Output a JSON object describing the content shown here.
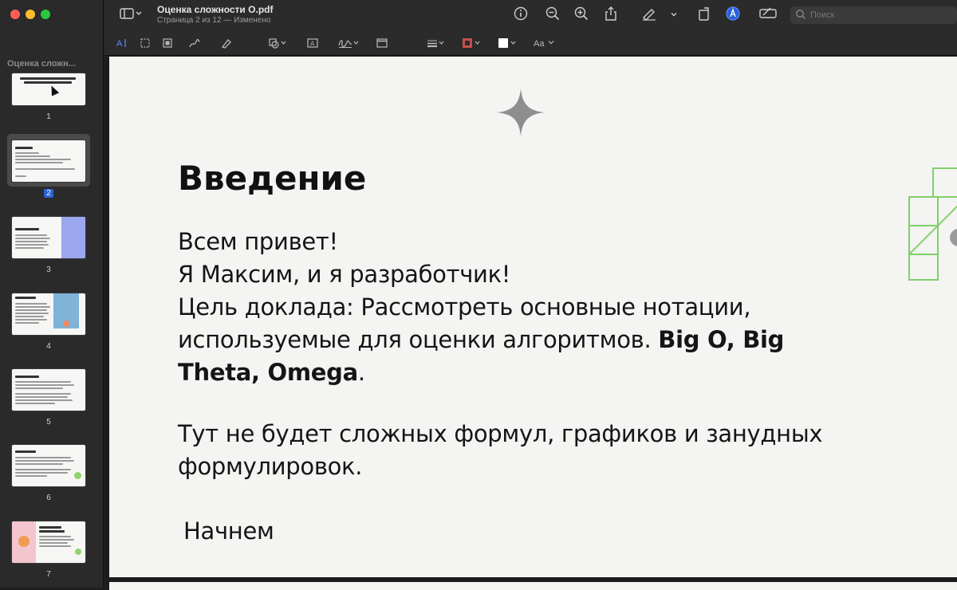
{
  "window": {
    "title": "Оценка сложности O.pdf",
    "subtitle": "Страница 2 из 12 — Изменено"
  },
  "sidebar": {
    "header": "Оценка сложн...",
    "pages": [
      {
        "num": "1",
        "thumb_title": "Оценка сложности алгоритмов и нотации Big O, Big Theta, Omega"
      },
      {
        "num": "2",
        "thumb_title": "Введение",
        "selected": true
      },
      {
        "num": "3",
        "thumb_title": "Оценка сложности"
      },
      {
        "num": "4",
        "thumb_title": "Нотация Big O"
      },
      {
        "num": "5",
        "thumb_title": "Нотация Big Theta"
      },
      {
        "num": "6",
        "thumb_title": "Нотация Omega"
      },
      {
        "num": "7",
        "thumb_title": "Примеры использования"
      }
    ]
  },
  "toolbar": {
    "sidebar_toggle_icon": "sidebar-icon",
    "search_placeholder": "Поиск",
    "font_label": "Aa"
  },
  "slide": {
    "title": "Введение",
    "line1": "Всем привет!",
    "line2": "Я Максим, и я разработчик!",
    "line3": "Цель доклада: Рассмотреть основные нотации,",
    "line4_pre": "используемые для оценки алгоритмов. ",
    "line4_bold": "Big O, Big",
    "line5_bold": "Theta, Omega",
    "line5_post": ".",
    "line6": "Тут не будет сложных формул, графиков и занудных",
    "line7": "формулировок.",
    "line8": "Начнем"
  },
  "colors": {
    "accent": "#2a62d6",
    "deco_green": "#7fd06a",
    "star": "#8e8e8e"
  }
}
